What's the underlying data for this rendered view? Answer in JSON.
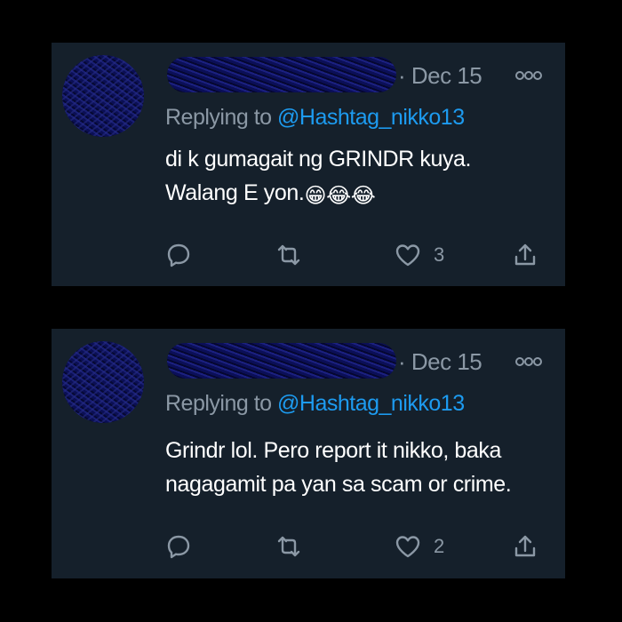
{
  "tweets": [
    {
      "date": "· Dec 15",
      "replying_prefix": "Replying to ",
      "replying_handle": "@Hashtag_nikko13",
      "line1": "di k gumagait ng GRINDR kuya.",
      "line2": "Walang E yon.",
      "emojis": [
        "😁",
        "😂",
        "😂"
      ],
      "like_count": "3"
    },
    {
      "date": "· Dec 15",
      "replying_prefix": "Replying to ",
      "replying_handle": "@Hashtag_nikko13",
      "line1": "Grindr lol. Pero report it nikko, baka",
      "line2": "nagagamit pa yan sa scam or crime.",
      "emojis": [],
      "like_count": "2"
    }
  ],
  "colors": {
    "background": "#000000",
    "card": "#15202b",
    "muted_text": "#8b98a5",
    "link": "#1d9bf0",
    "text": "#ffffff"
  },
  "icons": [
    "more-icon",
    "reply-icon",
    "retweet-icon",
    "like-icon",
    "share-icon"
  ]
}
